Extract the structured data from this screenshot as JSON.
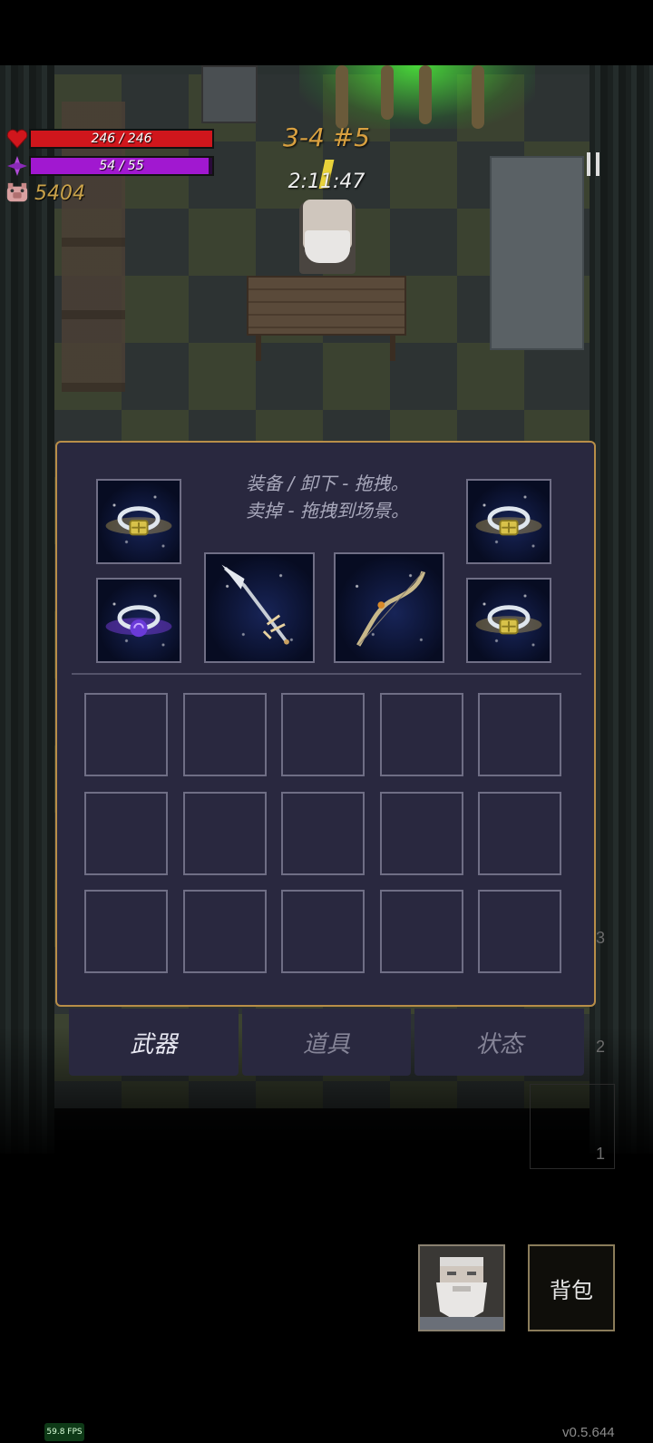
{
  "hud": {
    "hp": {
      "current": 246,
      "max": 246,
      "text": "246 / 246",
      "color": "#d0161c",
      "icon": "heart-icon"
    },
    "mp": {
      "current": 54,
      "max": 55,
      "text": "54 / 55",
      "color": "#a118d0",
      "icon": "mana-crystal-icon"
    },
    "gold": {
      "value": "5404",
      "icon": "pig-coin-icon"
    },
    "level": "3-4 #5",
    "timer": "2:11:47"
  },
  "inventory": {
    "hint_line1": "装备 / 卸下 - 拖拽。",
    "hint_line2": "卖掉 - 拖拽到场景。",
    "equipment": {
      "ring_top_left": "gold-gem-ring-icon",
      "ring_bottom_left": "purple-swirl-ring-icon",
      "weapon": "spear-icon",
      "offhand": "bow-icon",
      "ring_top_right": "gold-gem-ring-icon",
      "ring_bottom_right": "gold-gem-ring-icon"
    },
    "grid_rows": 3,
    "grid_cols": 5
  },
  "tabs": [
    {
      "label": "武器",
      "active": true
    },
    {
      "label": "道具",
      "active": false
    },
    {
      "label": "状态",
      "active": false
    }
  ],
  "side_numbers": [
    "3",
    "2",
    "1"
  ],
  "bottom": {
    "bag_label": "背包",
    "portrait_icon": "bearded-old-man-portrait"
  },
  "fps": "59.8 FPS",
  "version": "v0.5.644",
  "colors": {
    "panel_bg": "#29283f",
    "panel_border": "#b88e48",
    "level_text": "#d8a040",
    "gold_text": "#c9a24a"
  }
}
